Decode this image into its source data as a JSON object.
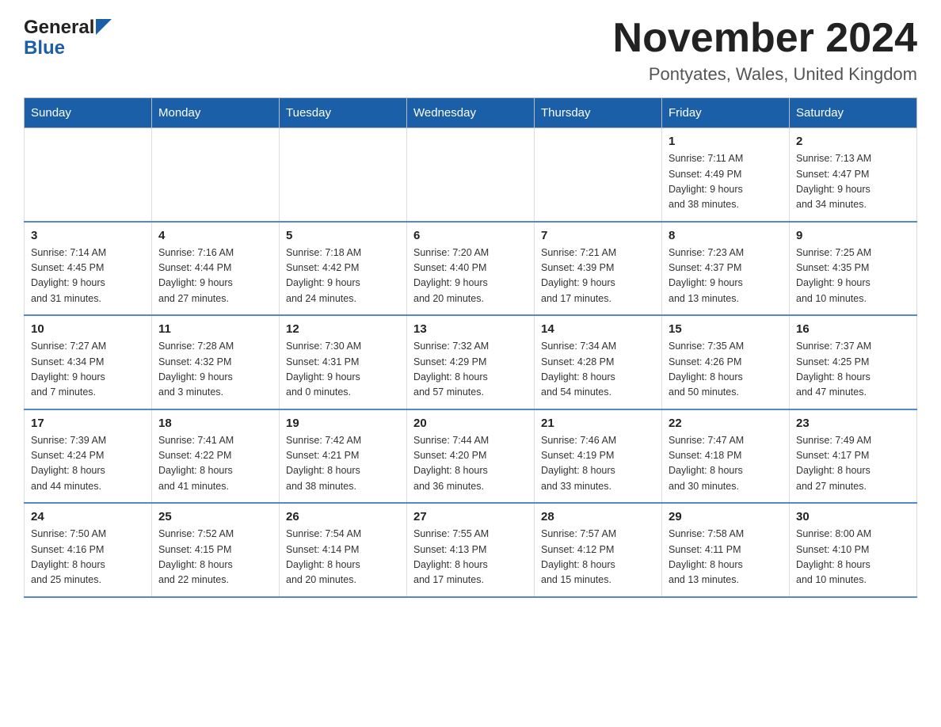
{
  "header": {
    "logo_general": "General",
    "logo_blue": "Blue",
    "title": "November 2024",
    "subtitle": "Pontyates, Wales, United Kingdom"
  },
  "calendar": {
    "days_of_week": [
      "Sunday",
      "Monday",
      "Tuesday",
      "Wednesday",
      "Thursday",
      "Friday",
      "Saturday"
    ],
    "weeks": [
      [
        {
          "day": "",
          "info": ""
        },
        {
          "day": "",
          "info": ""
        },
        {
          "day": "",
          "info": ""
        },
        {
          "day": "",
          "info": ""
        },
        {
          "day": "",
          "info": ""
        },
        {
          "day": "1",
          "info": "Sunrise: 7:11 AM\nSunset: 4:49 PM\nDaylight: 9 hours\nand 38 minutes."
        },
        {
          "day": "2",
          "info": "Sunrise: 7:13 AM\nSunset: 4:47 PM\nDaylight: 9 hours\nand 34 minutes."
        }
      ],
      [
        {
          "day": "3",
          "info": "Sunrise: 7:14 AM\nSunset: 4:45 PM\nDaylight: 9 hours\nand 31 minutes."
        },
        {
          "day": "4",
          "info": "Sunrise: 7:16 AM\nSunset: 4:44 PM\nDaylight: 9 hours\nand 27 minutes."
        },
        {
          "day": "5",
          "info": "Sunrise: 7:18 AM\nSunset: 4:42 PM\nDaylight: 9 hours\nand 24 minutes."
        },
        {
          "day": "6",
          "info": "Sunrise: 7:20 AM\nSunset: 4:40 PM\nDaylight: 9 hours\nand 20 minutes."
        },
        {
          "day": "7",
          "info": "Sunrise: 7:21 AM\nSunset: 4:39 PM\nDaylight: 9 hours\nand 17 minutes."
        },
        {
          "day": "8",
          "info": "Sunrise: 7:23 AM\nSunset: 4:37 PM\nDaylight: 9 hours\nand 13 minutes."
        },
        {
          "day": "9",
          "info": "Sunrise: 7:25 AM\nSunset: 4:35 PM\nDaylight: 9 hours\nand 10 minutes."
        }
      ],
      [
        {
          "day": "10",
          "info": "Sunrise: 7:27 AM\nSunset: 4:34 PM\nDaylight: 9 hours\nand 7 minutes."
        },
        {
          "day": "11",
          "info": "Sunrise: 7:28 AM\nSunset: 4:32 PM\nDaylight: 9 hours\nand 3 minutes."
        },
        {
          "day": "12",
          "info": "Sunrise: 7:30 AM\nSunset: 4:31 PM\nDaylight: 9 hours\nand 0 minutes."
        },
        {
          "day": "13",
          "info": "Sunrise: 7:32 AM\nSunset: 4:29 PM\nDaylight: 8 hours\nand 57 minutes."
        },
        {
          "day": "14",
          "info": "Sunrise: 7:34 AM\nSunset: 4:28 PM\nDaylight: 8 hours\nand 54 minutes."
        },
        {
          "day": "15",
          "info": "Sunrise: 7:35 AM\nSunset: 4:26 PM\nDaylight: 8 hours\nand 50 minutes."
        },
        {
          "day": "16",
          "info": "Sunrise: 7:37 AM\nSunset: 4:25 PM\nDaylight: 8 hours\nand 47 minutes."
        }
      ],
      [
        {
          "day": "17",
          "info": "Sunrise: 7:39 AM\nSunset: 4:24 PM\nDaylight: 8 hours\nand 44 minutes."
        },
        {
          "day": "18",
          "info": "Sunrise: 7:41 AM\nSunset: 4:22 PM\nDaylight: 8 hours\nand 41 minutes."
        },
        {
          "day": "19",
          "info": "Sunrise: 7:42 AM\nSunset: 4:21 PM\nDaylight: 8 hours\nand 38 minutes."
        },
        {
          "day": "20",
          "info": "Sunrise: 7:44 AM\nSunset: 4:20 PM\nDaylight: 8 hours\nand 36 minutes."
        },
        {
          "day": "21",
          "info": "Sunrise: 7:46 AM\nSunset: 4:19 PM\nDaylight: 8 hours\nand 33 minutes."
        },
        {
          "day": "22",
          "info": "Sunrise: 7:47 AM\nSunset: 4:18 PM\nDaylight: 8 hours\nand 30 minutes."
        },
        {
          "day": "23",
          "info": "Sunrise: 7:49 AM\nSunset: 4:17 PM\nDaylight: 8 hours\nand 27 minutes."
        }
      ],
      [
        {
          "day": "24",
          "info": "Sunrise: 7:50 AM\nSunset: 4:16 PM\nDaylight: 8 hours\nand 25 minutes."
        },
        {
          "day": "25",
          "info": "Sunrise: 7:52 AM\nSunset: 4:15 PM\nDaylight: 8 hours\nand 22 minutes."
        },
        {
          "day": "26",
          "info": "Sunrise: 7:54 AM\nSunset: 4:14 PM\nDaylight: 8 hours\nand 20 minutes."
        },
        {
          "day": "27",
          "info": "Sunrise: 7:55 AM\nSunset: 4:13 PM\nDaylight: 8 hours\nand 17 minutes."
        },
        {
          "day": "28",
          "info": "Sunrise: 7:57 AM\nSunset: 4:12 PM\nDaylight: 8 hours\nand 15 minutes."
        },
        {
          "day": "29",
          "info": "Sunrise: 7:58 AM\nSunset: 4:11 PM\nDaylight: 8 hours\nand 13 minutes."
        },
        {
          "day": "30",
          "info": "Sunrise: 8:00 AM\nSunset: 4:10 PM\nDaylight: 8 hours\nand 10 minutes."
        }
      ]
    ]
  }
}
